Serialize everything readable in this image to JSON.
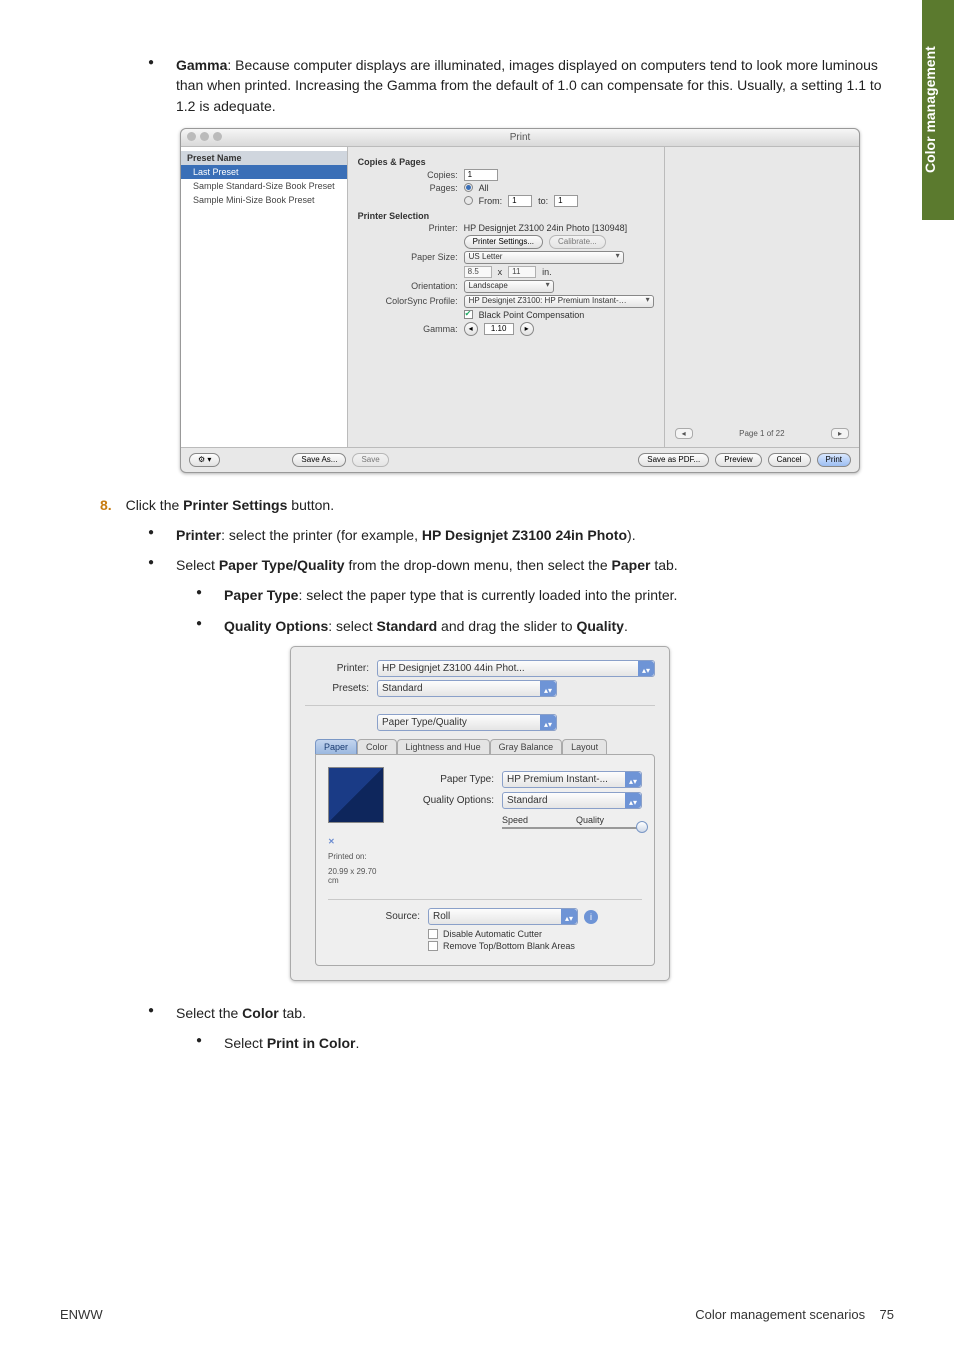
{
  "sidebar_label": "Color management",
  "body": {
    "gamma_para": {
      "lead": "Gamma",
      "text": ": Because computer displays are illuminated, images displayed on computers tend to look more luminous than when printed. Increasing the Gamma from the default of 1.0 can compensate for this. Usually, a setting 1.1 to 1.2 is adequate."
    },
    "step8_num": "8.",
    "step8_text_pre": "Click the ",
    "step8_bold": "Printer Settings",
    "step8_text_post": " button.",
    "printer_li": {
      "lead": "Printer",
      "mid": ": select the printer (for example, ",
      "bold2": "HP Designjet Z3100 24in Photo",
      "tail": ")."
    },
    "paper_li": {
      "pre": "Select ",
      "b1": "Paper Type/Quality",
      "mid": " from the drop-down menu, then select the ",
      "b2": "Paper",
      "tail": " tab."
    },
    "papertype_li": {
      "lead": "Paper Type",
      "tail": ": select the paper type that is currently loaded into the printer."
    },
    "quality_li": {
      "lead": "Quality Options",
      "mid": ": select ",
      "b1": "Standard",
      "mid2": " and drag the slider to ",
      "b2": "Quality",
      "tail": "."
    },
    "color_tab_li": {
      "pre": "Select the ",
      "b": "Color",
      "post": " tab."
    },
    "print_color_li": {
      "pre": "Select ",
      "b": "Print in Color",
      "post": "."
    }
  },
  "aperture": {
    "title": "Print",
    "presets_header": "Preset Name",
    "presets": [
      "Last Preset",
      "Sample Standard-Size Book Preset",
      "Sample Mini-Size Book Preset"
    ],
    "copies_section": "Copies & Pages",
    "copies_label": "Copies:",
    "copies_value": "1",
    "pages_label": "Pages:",
    "pages_all": "All",
    "pages_from": "From:",
    "pages_from_v": "1",
    "pages_to": "to:",
    "pages_to_v": "1",
    "printer_sel_section": "Printer Selection",
    "printer_label": "Printer:",
    "printer_value": "HP Designjet Z3100 24in Photo [130948]",
    "printer_settings_btn": "Printer Settings...",
    "calibrate_btn": "Calibrate...",
    "paper_size_label": "Paper Size:",
    "paper_size_value": "US Letter",
    "paper_dims_w": "8.5",
    "paper_dims_x": "x",
    "paper_dims_h": "11",
    "paper_dims_unit": "in.",
    "orientation_label": "Orientation:",
    "orientation_value": "Landscape",
    "colorsync_label": "ColorSync Profile:",
    "colorsync_value": "HP Designjet Z3100: HP Premium Instant-…",
    "bpc_label": "Black Point Compensation",
    "gamma_label": "Gamma:",
    "gamma_value": "1.10",
    "page_indicator": "Page 1 of 22",
    "gear_btn": "⚙ ▾",
    "save_as_btn": "Save As...",
    "save_btn": "Save",
    "save_pdf_btn": "Save as PDF...",
    "preview_btn": "Preview",
    "cancel_btn": "Cancel",
    "print_btn": "Print"
  },
  "printer_settings": {
    "printer_label": "Printer:",
    "printer_value": "HP Designjet Z3100 44in Phot...",
    "presets_label": "Presets:",
    "presets_value": "Standard",
    "panel_dropdown": "Paper Type/Quality",
    "tabs": [
      "Paper",
      "Color",
      "Lightness and Hue",
      "Gray Balance",
      "Layout"
    ],
    "paper_type_label": "Paper Type:",
    "paper_type_value": "HP Premium Instant-...",
    "quality_options_label": "Quality Options:",
    "quality_options_value": "Standard",
    "slider_left": "Speed",
    "slider_right": "Quality",
    "printed_on_label": "Printed on:",
    "printed_on_value": "20.99 x 29.70 cm",
    "source_label": "Source:",
    "source_value": "Roll",
    "chk1": "Disable Automatic Cutter",
    "chk2": "Remove Top/Bottom Blank Areas"
  },
  "footer": {
    "left": "ENWW",
    "right_label": "Color management scenarios",
    "page": "75"
  }
}
